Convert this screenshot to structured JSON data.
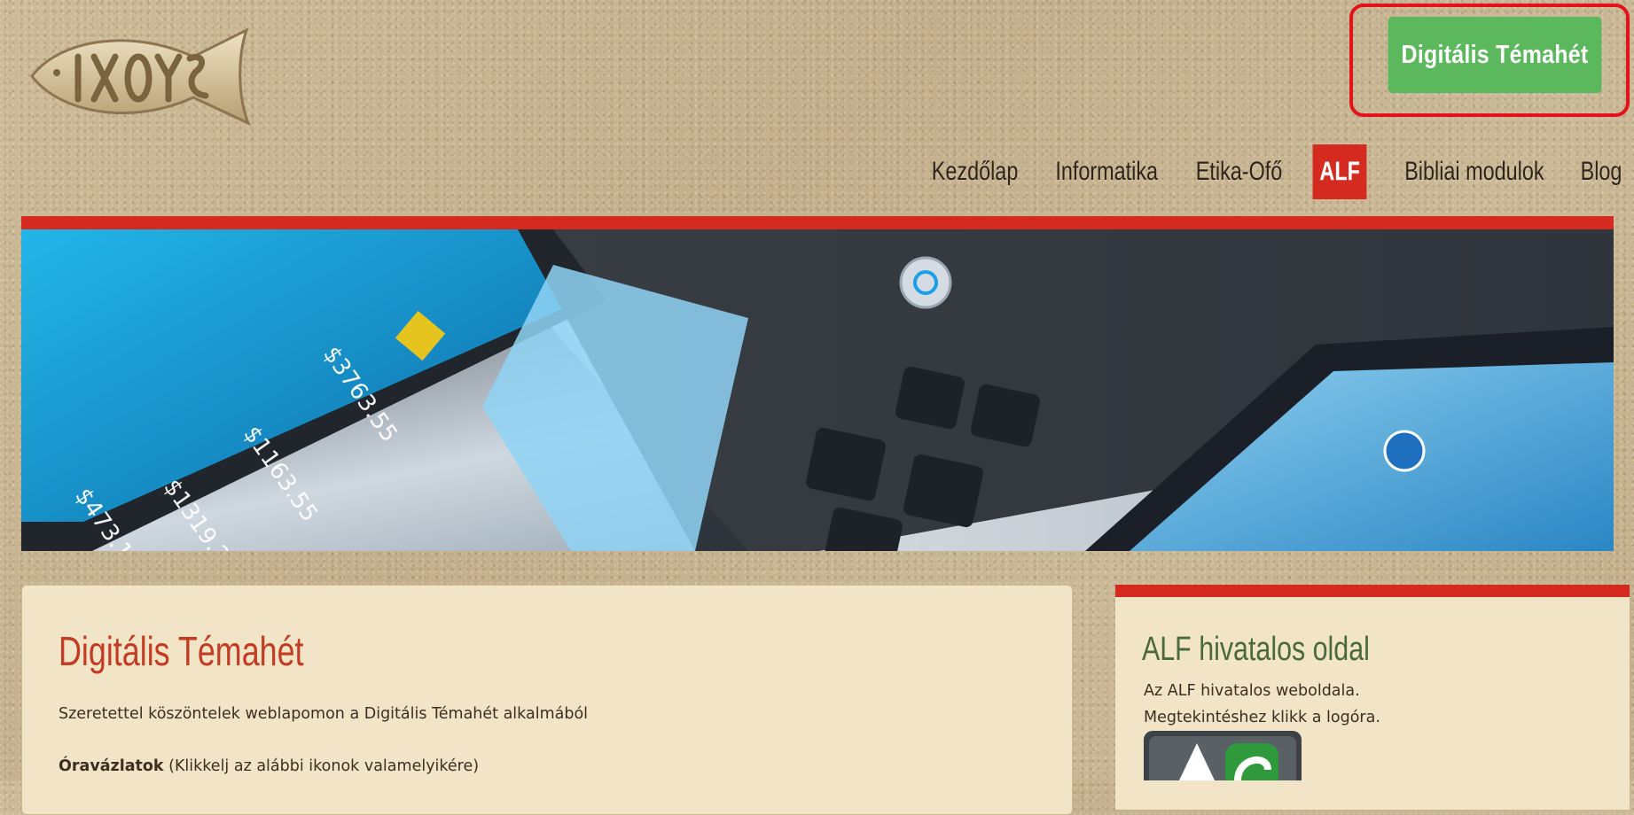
{
  "header": {
    "cta_button": "Digitális Témahét"
  },
  "nav": {
    "items": [
      "Kezdőlap",
      "Informatika",
      "Etika-Ofő",
      "ALF",
      "Bibliai modulok",
      "Blog"
    ],
    "active_index": 3
  },
  "main": {
    "title": "Digitális Témahét",
    "intro": "Szeretettel köszöntelek weblapomon a Digitális Témahét alkalmából",
    "lesson_bold": "Óravázlatok",
    "lesson_rest": " (Klikkelj az alábbi ikonok valamelyikére)"
  },
  "sidebar": {
    "title": "ALF hivatalos oldal",
    "line1": "Az ALF hivatalos weboldala.",
    "line2": "Megtekintéshez klikk a logóra."
  },
  "colors": {
    "accent_red": "#d42a20",
    "cta_green": "#5cb85c",
    "panel_bg": "#f2e4c7",
    "title_red": "#c33b22",
    "sidebar_title_green": "#4b6a3a"
  },
  "icons": [
    "ichthys-fish-logo",
    "alf-logo"
  ]
}
